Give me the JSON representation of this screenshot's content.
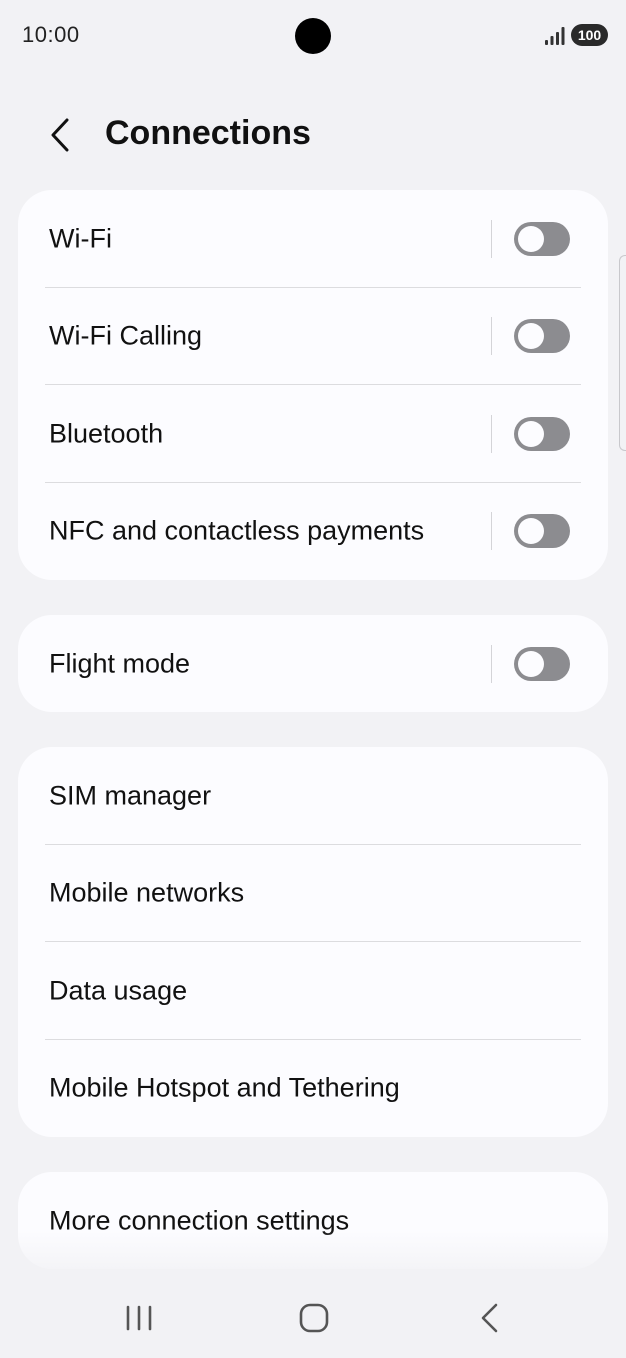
{
  "status_bar": {
    "time": "10:00",
    "battery": "100"
  },
  "header": {
    "title": "Connections"
  },
  "card1": {
    "items": [
      {
        "label": "Wi-Fi",
        "toggle": "off"
      },
      {
        "label": "Wi-Fi Calling",
        "toggle": "off"
      },
      {
        "label": "Bluetooth",
        "toggle": "off"
      },
      {
        "label": "NFC and contactless payments",
        "toggle": "off"
      }
    ]
  },
  "card2": {
    "items": [
      {
        "label": "Flight mode",
        "toggle": "off"
      }
    ]
  },
  "card3": {
    "items": [
      {
        "label": "SIM manager"
      },
      {
        "label": "Mobile networks"
      },
      {
        "label": "Data usage"
      },
      {
        "label": "Mobile Hotspot and Tethering"
      }
    ]
  },
  "card4": {
    "items": [
      {
        "label": "More connection settings"
      }
    ]
  },
  "nav": {
    "icons": [
      "recent-apps-icon",
      "home-icon",
      "back-icon"
    ]
  },
  "colors": {
    "background": "#f2f2f5",
    "card": "#fcfcff",
    "toggle_off": "#8c8c90",
    "text": "#111111"
  }
}
